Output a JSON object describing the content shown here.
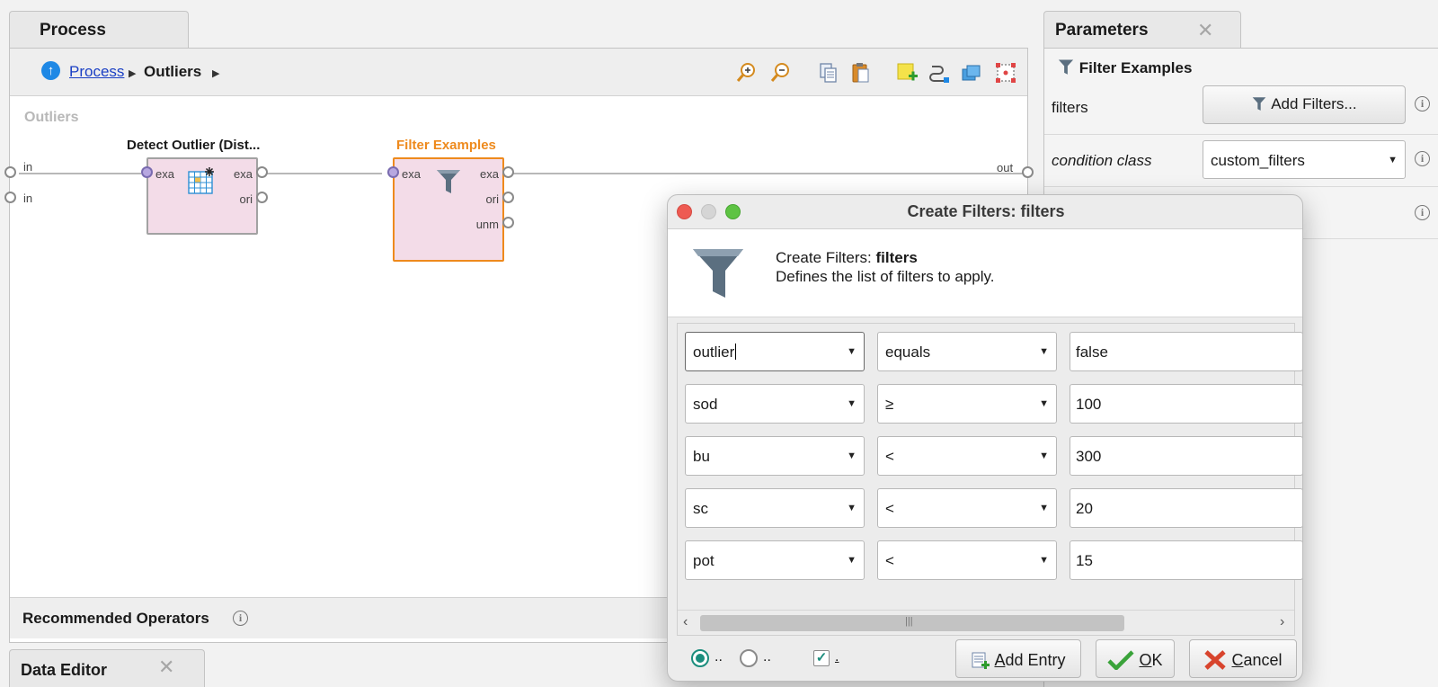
{
  "process": {
    "tab_title": "Process",
    "breadcrumb": {
      "root": "Process",
      "current": "Outliers"
    },
    "canvas_label": "Outliers",
    "operators": [
      {
        "title": "Detect Outlier (Dist...",
        "in_ports": [
          "exa"
        ],
        "out_ports": [
          "exa",
          "ori"
        ]
      },
      {
        "title": "Filter Examples",
        "in_ports": [
          "exa"
        ],
        "out_ports": [
          "exa",
          "ori",
          "unm"
        ]
      }
    ],
    "left_ports": [
      "in",
      "in"
    ],
    "right_ports": [
      "out"
    ],
    "recommended_label": "Recommended Operators"
  },
  "data_editor": {
    "tab_title": "Data Editor"
  },
  "parameters": {
    "tab_title": "Parameters",
    "operator_name": "Filter Examples",
    "rows": [
      {
        "label": "filters",
        "button": "Add Filters..."
      },
      {
        "label": "condition class",
        "value": "custom_filters"
      }
    ]
  },
  "dialog": {
    "title": "Create Filters: filters",
    "header_title_prefix": "Create Filters: ",
    "header_title_bold": "filters",
    "header_desc": "Defines the list of filters to apply.",
    "filters": [
      {
        "attribute": "outlier",
        "operator": "equals",
        "value": "false"
      },
      {
        "attribute": "sod",
        "operator": "≥",
        "value": "100"
      },
      {
        "attribute": "bu",
        "operator": "<",
        "value": "300"
      },
      {
        "attribute": "sc",
        "operator": "<",
        "value": "20"
      },
      {
        "attribute": "pot",
        "operator": "<",
        "value": "15"
      }
    ],
    "footer": {
      "radio1_label": "..",
      "radio2_label": "..",
      "checkbox_label": ".",
      "add_entry_first": "A",
      "add_entry_rest": "dd Entry",
      "ok_first": "O",
      "ok_rest": "K",
      "cancel_first": "C",
      "cancel_rest": "ancel"
    }
  },
  "colors": {
    "selected_operator": "#ee8a1d",
    "operator_fill": "#f3dce8",
    "link": "#1a3fc4",
    "radio_accent": "#1b8d7d"
  }
}
